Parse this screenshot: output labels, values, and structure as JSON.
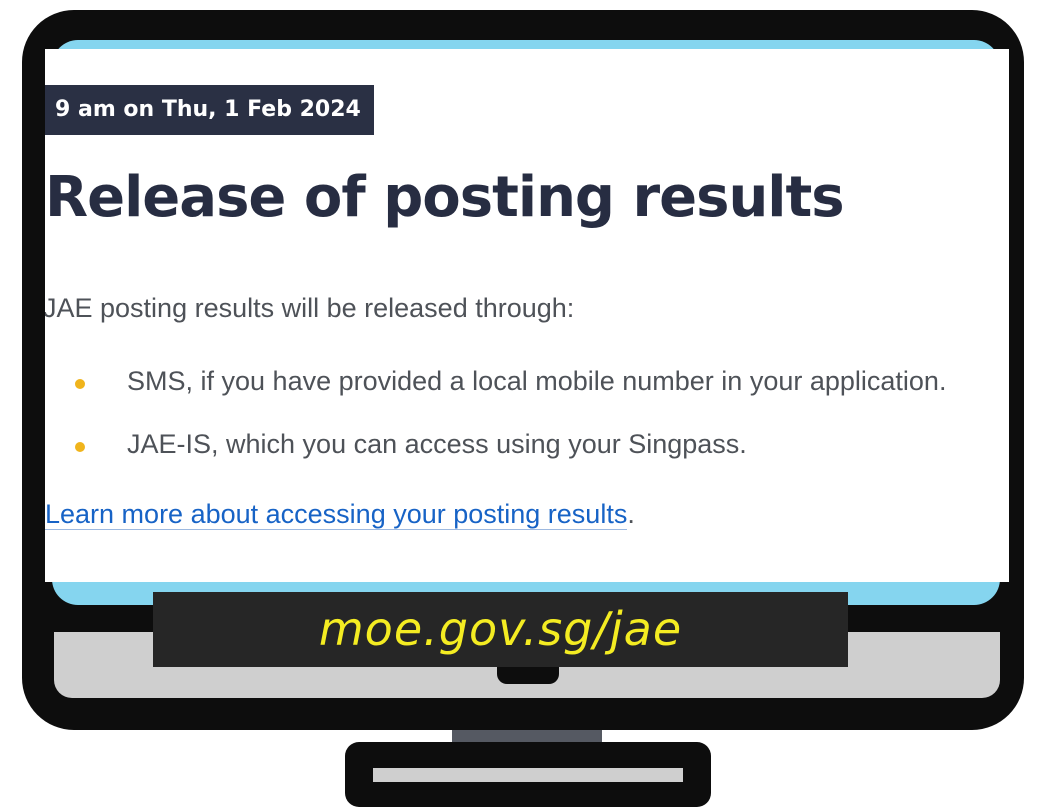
{
  "page": {
    "date_badge": "9 am on Thu, 1 Feb 2024",
    "title": "Release of posting results",
    "intro": "JAE posting results will be released through:",
    "bullets": [
      "SMS, if you have provided a local mobile number in your application.",
      "JAE-IS, which you can access using your Singpass."
    ],
    "learn_more_link": "Learn more about accessing your posting results",
    "learn_more_suffix": "."
  },
  "caption": {
    "url": "moe.gov.sg/jae"
  },
  "colors": {
    "badge_bg": "#2a3044",
    "title": "#272d42",
    "bullet": "#f0b41c",
    "link": "#1763c6",
    "screen_frame": "#85d5ef",
    "caption_text": "#f4ec22"
  }
}
